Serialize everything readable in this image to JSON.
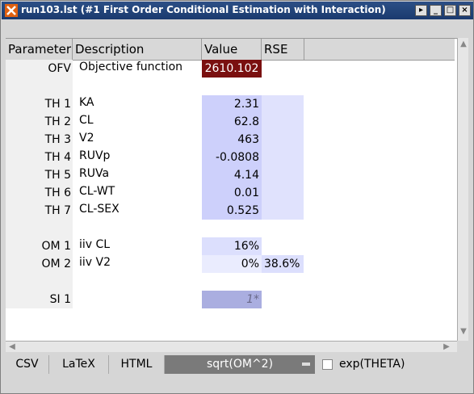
{
  "window": {
    "title": "run103.lst (#1 First Order Conditional Estimation with Interaction)",
    "buttons": [
      "▸",
      "_",
      "□",
      "×"
    ]
  },
  "table": {
    "headers": [
      "Parameter",
      "Description",
      "Value",
      "RSE"
    ],
    "ofv": {
      "param": "OFV",
      "desc": "Objective function",
      "value": "2610.102"
    },
    "thetas": [
      {
        "param": "TH 1",
        "desc": "KA",
        "value": "2.31"
      },
      {
        "param": "TH 2",
        "desc": "CL",
        "value": "62.8"
      },
      {
        "param": "TH 3",
        "desc": "V2",
        "value": "463"
      },
      {
        "param": "TH 4",
        "desc": "RUVp",
        "value": "-0.0808"
      },
      {
        "param": "TH 5",
        "desc": "RUVa",
        "value": "4.14"
      },
      {
        "param": "TH 6",
        "desc": "CL-WT",
        "value": "0.01"
      },
      {
        "param": "TH 7",
        "desc": "CL-SEX",
        "value": "0.525"
      }
    ],
    "omegas": [
      {
        "param": "OM 1",
        "desc": "iiv CL",
        "value": "16%",
        "rse": ""
      },
      {
        "param": "OM 2",
        "desc": "iiv V2",
        "value": "0%",
        "rse": "38.6%"
      }
    ],
    "sigmas": [
      {
        "param": "SI 1",
        "desc": "",
        "value": "1*"
      }
    ]
  },
  "toolbar": {
    "csv": "CSV",
    "latex": "LaTeX",
    "html": "HTML",
    "combo_value": "sqrt(OM^2)",
    "checkbox_label": "exp(THETA)",
    "checkbox_checked": false
  }
}
